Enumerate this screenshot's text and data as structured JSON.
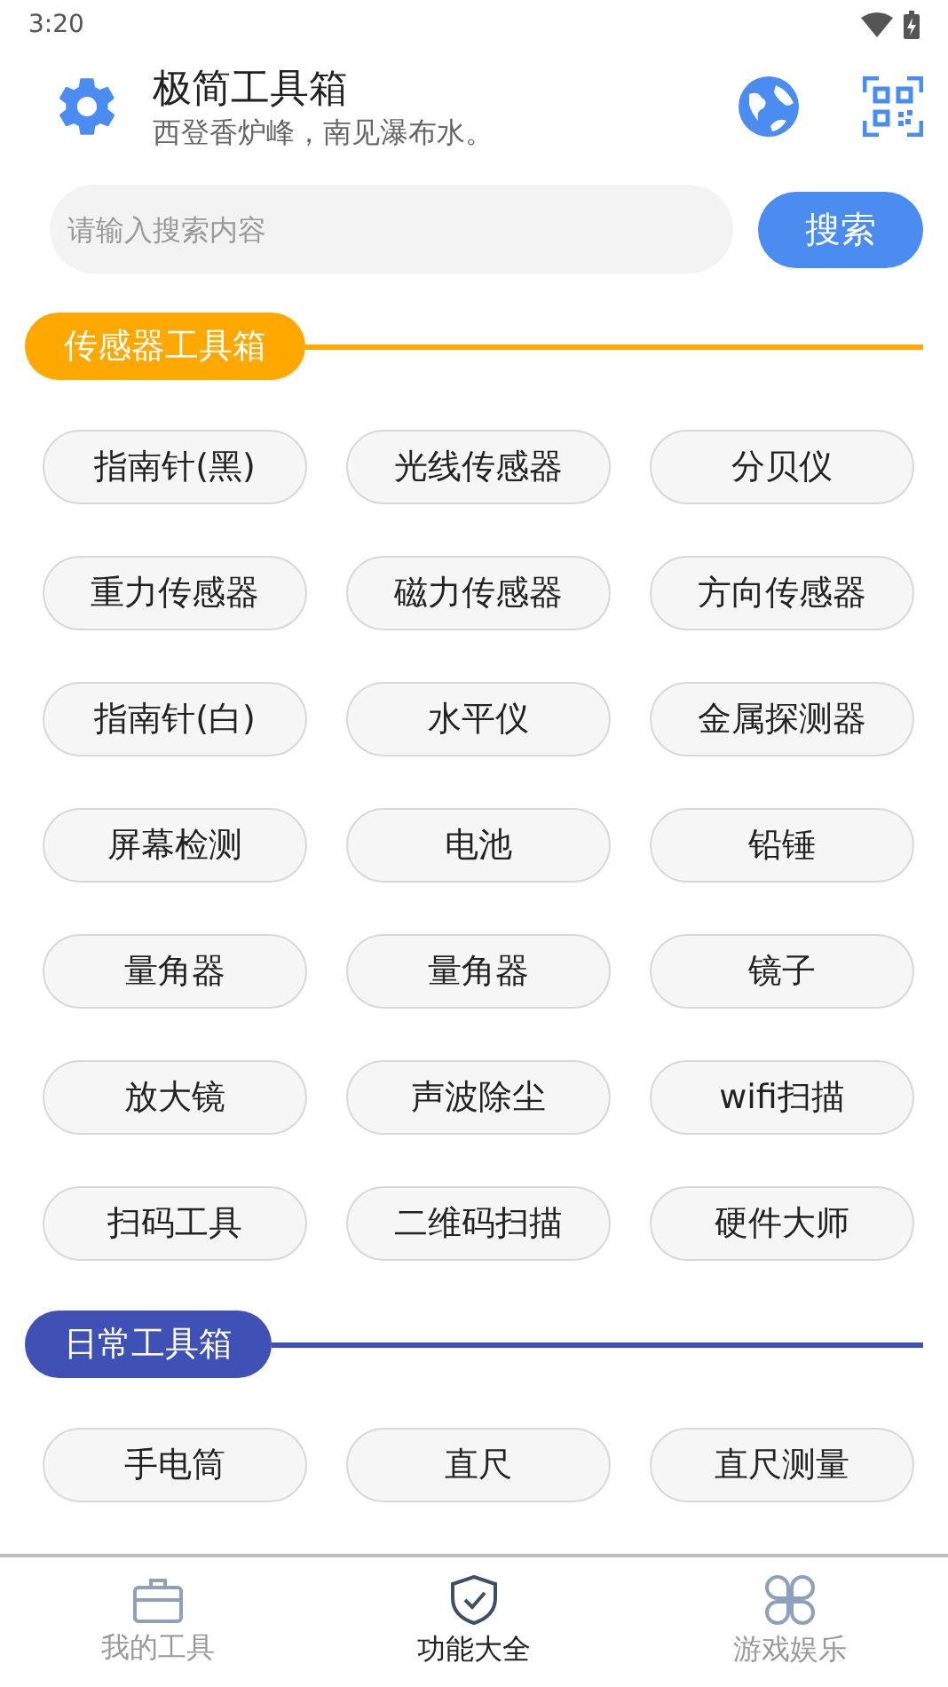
{
  "status_bar": {
    "time": "3:20"
  },
  "header": {
    "title": "极简工具箱",
    "subtitle": "西登香炉峰，南见瀑布水。"
  },
  "search": {
    "placeholder": "请输入搜索内容",
    "button": "搜索"
  },
  "sections": [
    {
      "title": "传感器工具箱",
      "color": "#ffa800",
      "items": [
        "指南针(黑)",
        "光线传感器",
        "分贝仪",
        "重力传感器",
        "磁力传感器",
        "方向传感器",
        "指南针(白)",
        "水平仪",
        "金属探测器",
        "屏幕检测",
        "电池",
        "铅锤",
        "量角器",
        "量角器",
        "镜子",
        "放大镜",
        "声波除尘",
        "wifi扫描",
        "扫码工具",
        "二维码扫描",
        "硬件大师"
      ]
    },
    {
      "title": "日常工具箱",
      "color": "#3f51b5",
      "items": [
        "手电筒",
        "直尺",
        "直尺测量"
      ]
    }
  ],
  "bottom_nav": [
    {
      "label": "我的工具",
      "selected": false
    },
    {
      "label": "功能大全",
      "selected": true
    },
    {
      "label": "游戏娱乐",
      "selected": false
    }
  ]
}
